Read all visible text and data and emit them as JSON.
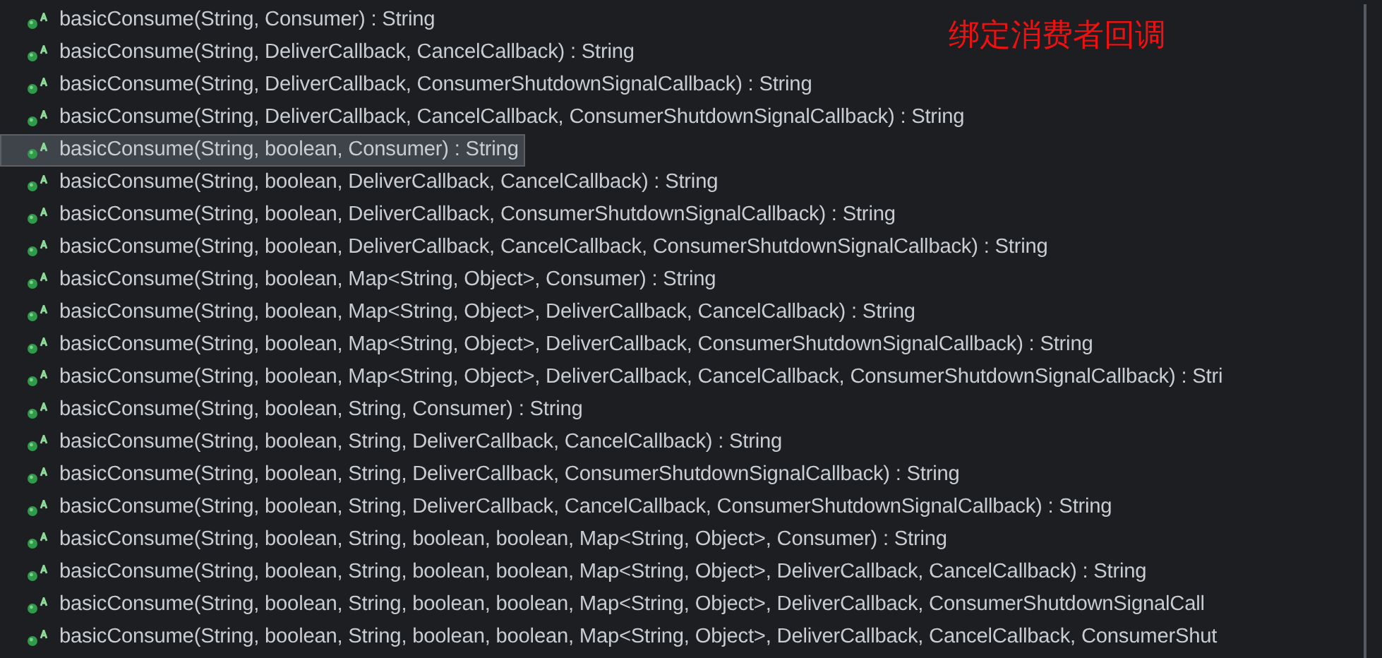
{
  "annotation": "绑定消费者回调",
  "methods": [
    {
      "label": "basicConsume(String, Consumer) : String",
      "selected": false
    },
    {
      "label": "basicConsume(String, DeliverCallback, CancelCallback) : String",
      "selected": false
    },
    {
      "label": "basicConsume(String, DeliverCallback, ConsumerShutdownSignalCallback) : String",
      "selected": false
    },
    {
      "label": "basicConsume(String, DeliverCallback, CancelCallback, ConsumerShutdownSignalCallback) : String",
      "selected": false
    },
    {
      "label": "basicConsume(String, boolean, Consumer) : String",
      "selected": true
    },
    {
      "label": "basicConsume(String, boolean, DeliverCallback, CancelCallback) : String",
      "selected": false
    },
    {
      "label": "basicConsume(String, boolean, DeliverCallback, ConsumerShutdownSignalCallback) : String",
      "selected": false
    },
    {
      "label": "basicConsume(String, boolean, DeliverCallback, CancelCallback, ConsumerShutdownSignalCallback) : String",
      "selected": false
    },
    {
      "label": "basicConsume(String, boolean, Map<String, Object>, Consumer) : String",
      "selected": false
    },
    {
      "label": "basicConsume(String, boolean, Map<String, Object>, DeliverCallback, CancelCallback) : String",
      "selected": false
    },
    {
      "label": "basicConsume(String, boolean, Map<String, Object>, DeliverCallback, ConsumerShutdownSignalCallback) : String",
      "selected": false
    },
    {
      "label": "basicConsume(String, boolean, Map<String, Object>, DeliverCallback, CancelCallback, ConsumerShutdownSignalCallback) : Stri",
      "selected": false
    },
    {
      "label": "basicConsume(String, boolean, String, Consumer) : String",
      "selected": false
    },
    {
      "label": "basicConsume(String, boolean, String, DeliverCallback, CancelCallback) : String",
      "selected": false
    },
    {
      "label": "basicConsume(String, boolean, String, DeliverCallback, ConsumerShutdownSignalCallback) : String",
      "selected": false
    },
    {
      "label": "basicConsume(String, boolean, String, DeliverCallback, CancelCallback, ConsumerShutdownSignalCallback) : String",
      "selected": false
    },
    {
      "label": "basicConsume(String, boolean, String, boolean, boolean, Map<String, Object>, Consumer) : String",
      "selected": false
    },
    {
      "label": "basicConsume(String, boolean, String, boolean, boolean, Map<String, Object>, DeliverCallback, CancelCallback) : String",
      "selected": false
    },
    {
      "label": "basicConsume(String, boolean, String, boolean, boolean, Map<String, Object>, DeliverCallback, ConsumerShutdownSignalCall",
      "selected": false
    },
    {
      "label": "basicConsume(String, boolean, String, boolean, boolean, Map<String, Object>, DeliverCallback, CancelCallback, ConsumerShut",
      "selected": false
    }
  ]
}
